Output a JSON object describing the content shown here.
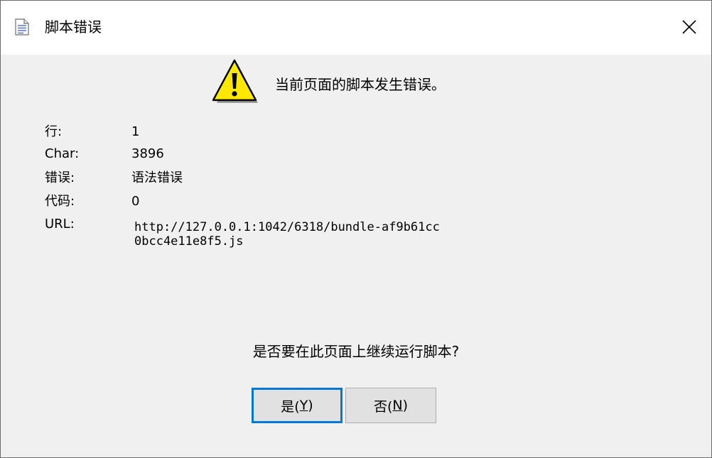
{
  "window": {
    "title": "脚本错误"
  },
  "dialog": {
    "message": "当前页面的脚本发生错误。",
    "fields": [
      {
        "label": "行:",
        "value": "1"
      },
      {
        "label": "Char:",
        "value": "3896"
      },
      {
        "label": "错误:",
        "value": "语法错误"
      },
      {
        "label": "代码:",
        "value": "0"
      },
      {
        "label": "URL:",
        "value": "http://127.0.0.1:1042/6318/bundle-af9b61cc0bcc4e11e8f5.js"
      }
    ],
    "question": "是否要在此页面上继续运行脚本?"
  },
  "buttons": {
    "yes_prefix": "是(",
    "yes_key": "Y",
    "yes_suffix": ")",
    "no_prefix": "否(",
    "no_key": "N",
    "no_suffix": ")"
  },
  "colors": {
    "dialog_bg": "#f0f0f0",
    "titlebar_bg": "#ffffff",
    "accent": "#0078d7",
    "warning_yellow": "#ffe800"
  },
  "icons": {
    "title": "document-icon",
    "close": "close-icon",
    "warning": "warning-icon"
  }
}
